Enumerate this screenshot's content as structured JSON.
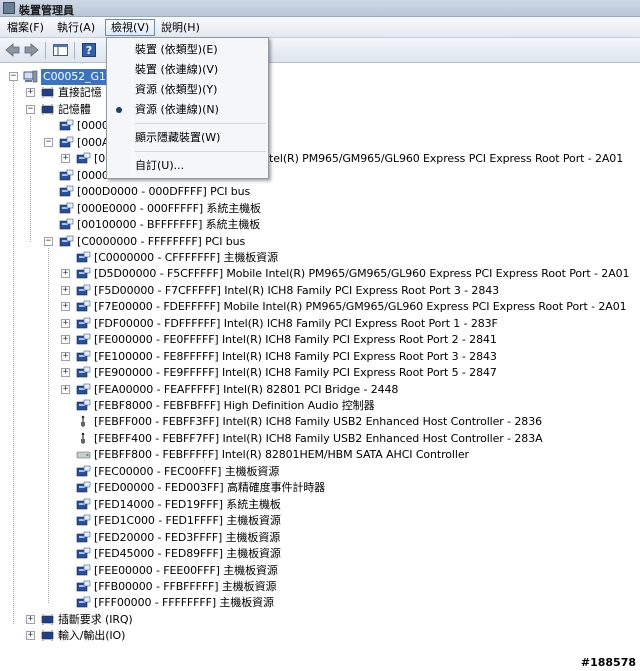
{
  "window": {
    "title": "裝置管理員"
  },
  "menubar": [
    {
      "label": "檔案(F)",
      "active": false
    },
    {
      "label": "執行(A)",
      "active": false
    },
    {
      "label": "檢視(V)",
      "active": true
    },
    {
      "label": "說明(H)",
      "active": false
    }
  ],
  "view_menu": {
    "items": [
      {
        "label": "裝置 (依類型)(E)",
        "checked": false
      },
      {
        "label": "裝置 (依連線)(V)",
        "checked": false
      },
      {
        "label": "資源 (依類型)(Y)",
        "checked": false
      },
      {
        "label": "資源 (依連線)(N)",
        "checked": true
      },
      {
        "label": "顯示隱藏裝置(W)",
        "checked": false
      },
      {
        "label": "自訂(U)...",
        "checked": false
      }
    ]
  },
  "tree": {
    "root": "C00052_G1",
    "dma": "直接記憶",
    "memory": "記憶體",
    "irq": "插斷要求 (IRQ)",
    "io": "輸入/輸出(IO)",
    "mem_rows": [
      "[0000",
      "[000A",
      "[0",
      "[0000",
      "[000D0000 - 000DFFFF]  PCI bus",
      "[000E0000 - 000FFFFF]  系統主機板",
      "[00100000 - BFFFFFFF]  系統主機板",
      "[C0000000 - FFFFFFFF]  PCI bus"
    ],
    "hidden_partial": "tel(R) PM965/GM965/GL960 Express PCI Express Root Port - 2A01",
    "pci_rows": [
      "[C0000000 - CFFFFFFF]  主機板資源",
      "[D5D00000 - F5CFFFFF]  Mobile Intel(R) PM965/GM965/GL960 Express PCI Express Root Port - 2A01",
      "[F5D00000 - F7CFFFFF]  Intel(R) ICH8 Family PCI Express Root Port 3 - 2843",
      "[F7E00000 - FDEFFFFF]  Mobile Intel(R) PM965/GM965/GL960 Express PCI Express Root Port - 2A01",
      "[FDF00000 - FDFFFFFF]  Intel(R) ICH8 Family PCI Express Root Port 1 - 283F",
      "[FE000000 - FE0FFFFF]  Intel(R) ICH8 Family PCI Express Root Port 2 - 2841",
      "[FE100000 - FE8FFFFF]  Intel(R) ICH8 Family PCI Express Root Port 3 - 2843",
      "[FE900000 - FE9FFFFF]  Intel(R) ICH8 Family PCI Express Root Port 5 - 2847",
      "[FEA00000 - FEAFFFFF]  Intel(R) 82801 PCI Bridge - 2448",
      "[FEBF8000 - FEBFBFFF]  High Definition Audio 控制器",
      "[FEBFF000 - FEBFF3FF]  Intel(R) ICH8 Family USB2 Enhanced Host Controller - 2836",
      "[FEBFF400 - FEBFF7FF]  Intel(R) ICH8 Family USB2 Enhanced Host Controller - 283A",
      "[FEBFF800 - FEBFFFFF]  Intel(R) 82801HEM/HBM SATA AHCI Controller",
      "[FEC00000 - FEC00FFF]  主機板資源",
      "[FED00000 - FED003FF]  高精確度事件計時器",
      "[FED14000 - FED19FFF]  系統主機板",
      "[FED1C000 - FED1FFFF]  主機板資源",
      "[FED20000 - FED3FFFF]  主機板資源",
      "[FED45000 - FED89FFF]  主機板資源",
      "[FEE00000 - FEE00FFF]  主機板資源",
      "[FFB00000 - FFBFFFFF]  主機板資源",
      "[FFF00000 - FFFFFFFF]  主機板資源"
    ]
  },
  "watermark": "#188578",
  "colors": {
    "selection": "#3a73c4",
    "device_icon": "#2a4f9a"
  }
}
